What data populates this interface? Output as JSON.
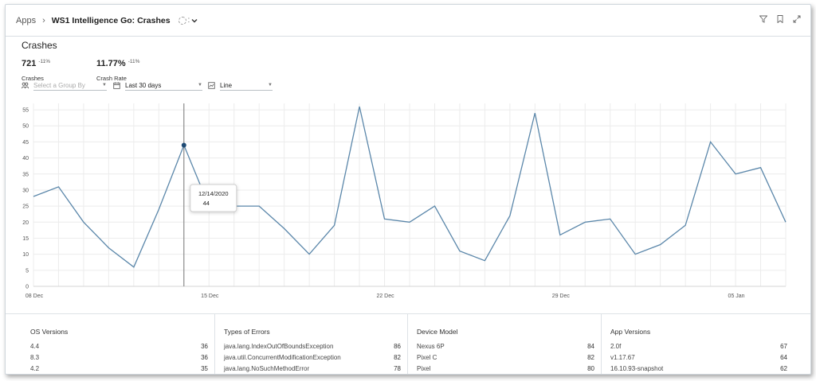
{
  "breadcrumb": {
    "root": "Apps",
    "current": "WS1 Intelligence Go: Crashes"
  },
  "icons": [
    "filter-icon",
    "bookmark-icon",
    "expand-icon",
    "status-icon",
    "chevron-down-icon",
    "group-icon",
    "calendar-icon",
    "chart-type-icon",
    "caret-down-icon"
  ],
  "section": {
    "title": "Crashes"
  },
  "metrics": [
    {
      "value": "721",
      "delta": "-11%",
      "label": "Crashes"
    },
    {
      "value": "11.77%",
      "delta": "-11%",
      "label": "Crash Rate"
    }
  ],
  "filters": {
    "group_by_placeholder": "Select a Group By",
    "date_range": "Last 30 days",
    "chart_type": "Line"
  },
  "tooltip": {
    "date": "12/14/2020",
    "value": "44"
  },
  "chart_data": {
    "type": "line",
    "x": [
      "12/08/2020",
      "12/09/2020",
      "12/10/2020",
      "12/11/2020",
      "12/12/2020",
      "12/13/2020",
      "12/14/2020",
      "12/15/2020",
      "12/16/2020",
      "12/17/2020",
      "12/18/2020",
      "12/19/2020",
      "12/20/2020",
      "12/21/2020",
      "12/22/2020",
      "12/23/2020",
      "12/24/2020",
      "12/25/2020",
      "12/26/2020",
      "12/27/2020",
      "12/28/2020",
      "12/29/2020",
      "12/30/2020",
      "12/31/2020",
      "01/01/2021",
      "01/02/2021",
      "01/03/2021",
      "01/04/2021",
      "01/05/2021",
      "01/06/2021",
      "01/07/2021"
    ],
    "values": [
      28,
      31,
      20,
      12,
      6,
      24,
      44,
      25,
      25,
      25,
      18,
      10,
      19,
      56,
      21,
      20,
      25,
      11,
      8,
      22,
      54,
      16,
      20,
      21,
      10,
      13,
      19,
      45,
      35,
      37,
      20
    ],
    "xticks": [
      "08 Dec",
      "15 Dec",
      "22 Dec",
      "29 Dec",
      "05 Jan"
    ],
    "yticks": [
      "0",
      "5",
      "10",
      "15",
      "20",
      "25",
      "30",
      "35",
      "40",
      "45",
      "50",
      "55"
    ],
    "ylim": [
      0,
      57
    ],
    "grid": true,
    "line_color": "#5b87aa",
    "highlight_index": 6
  },
  "panels": [
    {
      "title": "OS Versions",
      "rows": [
        {
          "name": "4.4",
          "value": "36"
        },
        {
          "name": "8.3",
          "value": "36"
        },
        {
          "name": "4.2",
          "value": "35"
        }
      ]
    },
    {
      "title": "Types of Errors",
      "rows": [
        {
          "name": "java.lang.IndexOutOfBoundsException",
          "value": "86"
        },
        {
          "name": "java.util.ConcurrentModificationException",
          "value": "82"
        },
        {
          "name": "java.lang.NoSuchMethodError",
          "value": "78"
        }
      ]
    },
    {
      "title": "Device Model",
      "rows": [
        {
          "name": "Nexus 6P",
          "value": "84"
        },
        {
          "name": "Pixel C",
          "value": "82"
        },
        {
          "name": "Pixel",
          "value": "80"
        }
      ]
    },
    {
      "title": "App Versions",
      "rows": [
        {
          "name": "2.0f",
          "value": "67"
        },
        {
          "name": "v1.17.67",
          "value": "64"
        },
        {
          "name": "16.10.93-snapshot",
          "value": "62"
        }
      ]
    }
  ]
}
